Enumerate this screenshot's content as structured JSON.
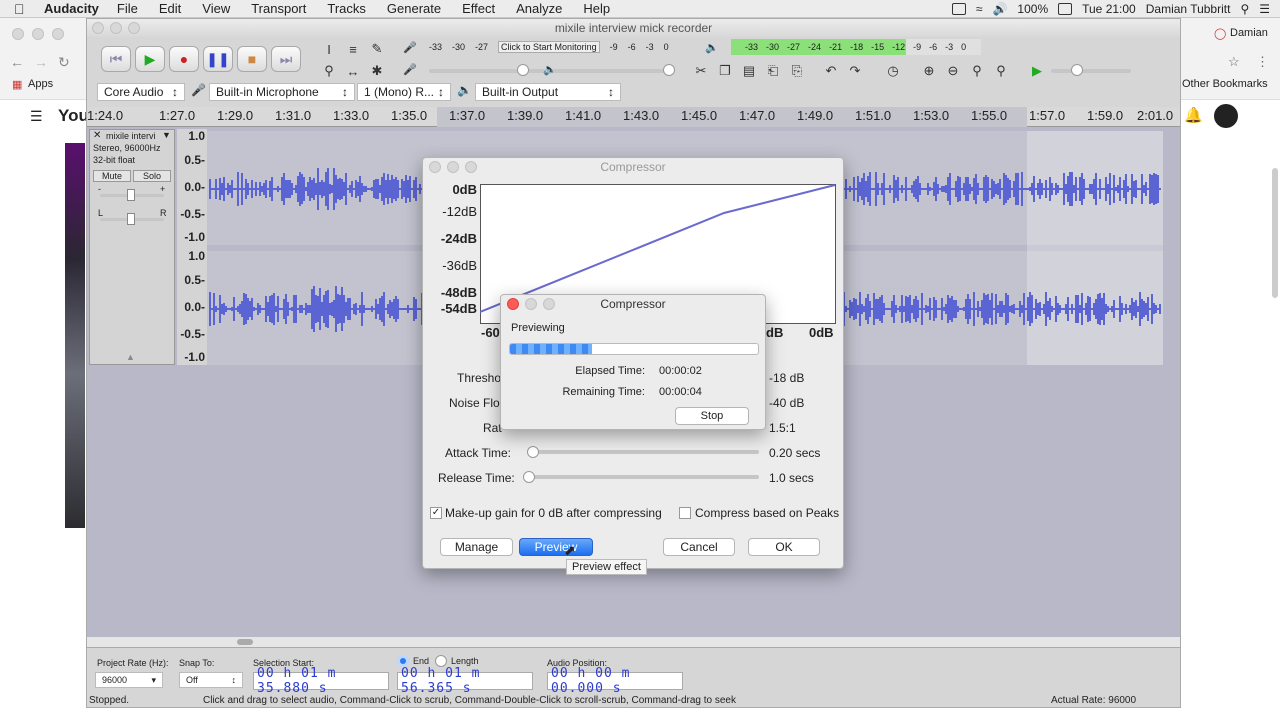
{
  "menubar": {
    "app": "Audacity",
    "items": [
      "File",
      "Edit",
      "View",
      "Transport",
      "Tracks",
      "Generate",
      "Effect",
      "Analyze",
      "Help"
    ],
    "battery": "100%",
    "clock": "Tue 21:00",
    "user": "Damian Tubbritt"
  },
  "browser": {
    "apps": "Apps",
    "bookmarks": "Other Bookmarks",
    "profile": "Damian",
    "yt_prefix": "You"
  },
  "audacity": {
    "title": "mixile interview mick recorder",
    "meter_hint": "Click to Start Monitoring",
    "rec_scale": [
      "-33",
      "-30",
      "-27",
      "-9",
      "-6",
      "-3",
      "0"
    ],
    "play_scale": [
      "-33",
      "-30",
      "-27",
      "-24",
      "-21",
      "-18",
      "-15",
      "-12",
      "-9",
      "-6",
      "-3",
      "0"
    ],
    "host": "Core Audio",
    "rec_device": "Built-in Microphone",
    "channels": "1 (Mono) R...",
    "play_device": "Built-in Output",
    "ruler": [
      "1:24.0",
      "1:27.0",
      "1:29.0",
      "1:31.0",
      "1:33.0",
      "1:35.0",
      "1:37.0",
      "1:39.0",
      "1:41.0",
      "1:43.0",
      "1:45.0",
      "1:47.0",
      "1:49.0",
      "1:51.0",
      "1:53.0",
      "1:55.0",
      "1:57.0",
      "1:59.0",
      "2:01.0"
    ],
    "track": {
      "name": "mixile intervi",
      "info1": "Stereo, 96000Hz",
      "info2": "32-bit float",
      "mute": "Mute",
      "solo": "Solo",
      "gain_l": "-",
      "gain_r": "+",
      "pan_l": "L",
      "pan_r": "R"
    },
    "yscale": [
      "1.0",
      "0.5-",
      "0.0-",
      "-0.5-",
      "-1.0"
    ],
    "status": {
      "rate_label": "Project Rate (Hz):",
      "rate": "96000",
      "snap_label": "Snap To:",
      "snap": "Off",
      "sel_label": "Selection Start:",
      "end_label": "End",
      "length_label": "Length",
      "pos_label": "Audio Position:",
      "sel_start": "00 h 01 m 35.880 s",
      "sel_end": "00 h 01 m 56.365 s",
      "pos": "00 h 00 m 00.000 s",
      "stopped": "Stopped.",
      "hint": "Click and drag to select audio, Command-Click to scrub, Command-Double-Click to scroll-scrub, Command-drag to seek",
      "actual_rate": "Actual Rate: 96000"
    }
  },
  "compressor": {
    "title": "Compressor",
    "db_labels": [
      "0dB",
      "-12dB",
      "-24dB",
      "-36dB",
      "-48dB",
      "-54dB"
    ],
    "x_labels": [
      "-60",
      "dB",
      "0dB"
    ],
    "threshold_label": "Thresho",
    "threshold": "-18 dB",
    "noise_label": "Noise Flo",
    "noise": "-40 dB",
    "ratio_label": "Rat",
    "ratio": "1.5:1",
    "attack_label": "Attack Time:",
    "attack": "0.20 secs",
    "release_label": "Release Time:",
    "release": "1.0 secs",
    "makeup": "Make-up gain for 0 dB after compressing",
    "peaks": "Compress based on Peaks",
    "manage": "Manage",
    "preview": "Preview",
    "cancel": "Cancel",
    "ok": "OK",
    "tooltip": "Preview effect"
  },
  "progress": {
    "title": "Compressor",
    "heading": "Previewing",
    "fraction": 0.33,
    "elapsed_label": "Elapsed Time:",
    "elapsed": "00:00:02",
    "remaining_label": "Remaining Time:",
    "remaining": "00:00:04",
    "stop": "Stop"
  }
}
